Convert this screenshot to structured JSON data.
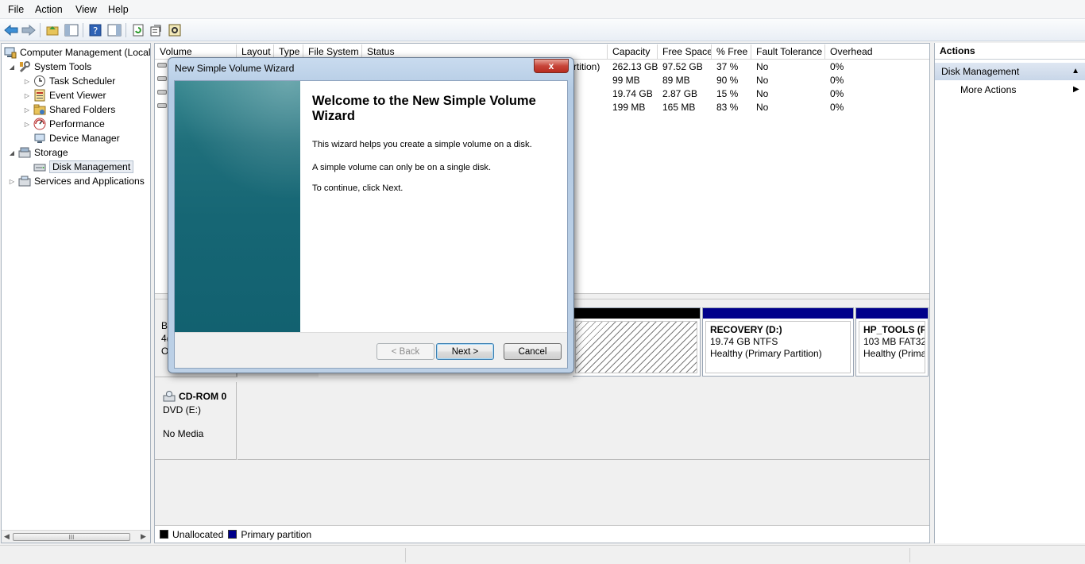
{
  "menu": [
    "File",
    "Action",
    "View",
    "Help"
  ],
  "tree": {
    "root": "Computer Management (Local",
    "system_tools": "System Tools",
    "task_scheduler": "Task Scheduler",
    "event_viewer": "Event Viewer",
    "shared_folders": "Shared Folders",
    "performance": "Performance",
    "device_manager": "Device Manager",
    "storage": "Storage",
    "disk_management": "Disk Management",
    "services": "Services and Applications",
    "scroll_grip": "III"
  },
  "volume_list": {
    "columns": [
      "Volume",
      "Layout",
      "Type",
      "File System",
      "Status",
      "Capacity",
      "Free Space",
      "% Free",
      "Fault Tolerance",
      "Overhead"
    ],
    "status_fragment": "rtition)",
    "rows": [
      {
        "capacity": "262.13 GB",
        "free": "97.52 GB",
        "pct": "37 %",
        "fault": "No",
        "overhead": "0%"
      },
      {
        "capacity": "99 MB",
        "free": "89 MB",
        "pct": "90 %",
        "fault": "No",
        "overhead": "0%"
      },
      {
        "capacity": "19.74 GB",
        "free": "2.87 GB",
        "pct": "15 %",
        "fault": "No",
        "overhead": "0%"
      },
      {
        "capacity": "199 MB",
        "free": "165 MB",
        "pct": "83 %",
        "fault": "No",
        "overhead": "0%"
      }
    ]
  },
  "disk0": {
    "label_fragments": [
      "B",
      "4(",
      "O"
    ],
    "recovery": {
      "title": "RECOVERY  (D:)",
      "size": "19.74 GB NTFS",
      "status": "Healthy (Primary Partition)"
    },
    "hp_tools": {
      "title": "HP_TOOLS  (F:",
      "size": "103 MB FAT32",
      "status": "Healthy (Prima"
    }
  },
  "cdrom": {
    "name": "CD-ROM 0",
    "drive": "DVD (E:)",
    "media": "No Media"
  },
  "legend": {
    "unallocated": "Unallocated",
    "primary": "Primary partition"
  },
  "actions": {
    "title": "Actions",
    "section": "Disk Management",
    "more": "More Actions"
  },
  "wizard": {
    "title": "New Simple Volume Wizard",
    "close": "x",
    "heading": "Welcome to the New Simple Volume Wizard",
    "p1": "This wizard helps you create a simple volume on a disk.",
    "p2": "A simple volume can only be on a single disk.",
    "p3": "To continue, click Next.",
    "back": "< Back",
    "next": "Next >",
    "cancel": "Cancel"
  },
  "colors": {
    "unallocated": "#000000",
    "primary": "#00008b",
    "selection": "#e8ecf2",
    "banner": "#166674"
  }
}
